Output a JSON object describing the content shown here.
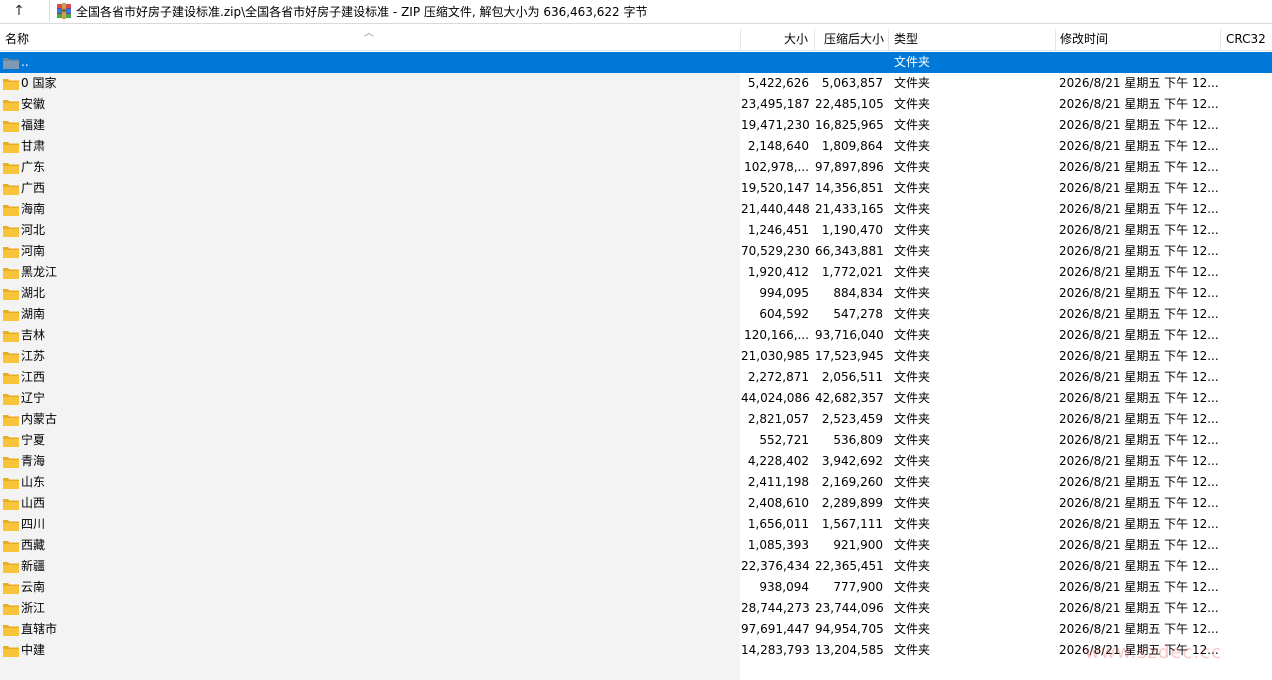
{
  "address_bar": {
    "path": "全国各省市好房子建设标准.zip\\全国各省市好房子建设标准 - ZIP 压缩文件, 解包大小为 636,463,622 字节",
    "up_glyph": "↑"
  },
  "columns": {
    "name": "名称",
    "size": "大小",
    "packed": "压缩后大小",
    "type": "类型",
    "modified": "修改时间",
    "crc": "CRC32"
  },
  "sort_glyph": "︿",
  "rows": [
    {
      "name": "..",
      "size": "",
      "packed": "",
      "type": "文件夹",
      "modified": "",
      "crc": "",
      "selected": true
    },
    {
      "name": "0 国家",
      "size": "5,422,626",
      "packed": "5,063,857",
      "type": "文件夹",
      "modified": "2026/8/21 星期五 下午 12...",
      "crc": ""
    },
    {
      "name": "安徽",
      "size": "23,495,187",
      "packed": "22,485,105",
      "type": "文件夹",
      "modified": "2026/8/21 星期五 下午 12...",
      "crc": ""
    },
    {
      "name": "福建",
      "size": "19,471,230",
      "packed": "16,825,965",
      "type": "文件夹",
      "modified": "2026/8/21 星期五 下午 12...",
      "crc": ""
    },
    {
      "name": "甘肃",
      "size": "2,148,640",
      "packed": "1,809,864",
      "type": "文件夹",
      "modified": "2026/8/21 星期五 下午 12...",
      "crc": ""
    },
    {
      "name": "广东",
      "size": "102,978,...",
      "packed": "97,897,896",
      "type": "文件夹",
      "modified": "2026/8/21 星期五 下午 12...",
      "crc": ""
    },
    {
      "name": "广西",
      "size": "19,520,147",
      "packed": "14,356,851",
      "type": "文件夹",
      "modified": "2026/8/21 星期五 下午 12...",
      "crc": ""
    },
    {
      "name": "海南",
      "size": "21,440,448",
      "packed": "21,433,165",
      "type": "文件夹",
      "modified": "2026/8/21 星期五 下午 12...",
      "crc": ""
    },
    {
      "name": "河北",
      "size": "1,246,451",
      "packed": "1,190,470",
      "type": "文件夹",
      "modified": "2026/8/21 星期五 下午 12...",
      "crc": ""
    },
    {
      "name": "河南",
      "size": "70,529,230",
      "packed": "66,343,881",
      "type": "文件夹",
      "modified": "2026/8/21 星期五 下午 12...",
      "crc": ""
    },
    {
      "name": "黑龙江",
      "size": "1,920,412",
      "packed": "1,772,021",
      "type": "文件夹",
      "modified": "2026/8/21 星期五 下午 12...",
      "crc": ""
    },
    {
      "name": "湖北",
      "size": "994,095",
      "packed": "884,834",
      "type": "文件夹",
      "modified": "2026/8/21 星期五 下午 12...",
      "crc": ""
    },
    {
      "name": "湖南",
      "size": "604,592",
      "packed": "547,278",
      "type": "文件夹",
      "modified": "2026/8/21 星期五 下午 12...",
      "crc": ""
    },
    {
      "name": "吉林",
      "size": "120,166,...",
      "packed": "93,716,040",
      "type": "文件夹",
      "modified": "2026/8/21 星期五 下午 12...",
      "crc": ""
    },
    {
      "name": "江苏",
      "size": "21,030,985",
      "packed": "17,523,945",
      "type": "文件夹",
      "modified": "2026/8/21 星期五 下午 12...",
      "crc": ""
    },
    {
      "name": "江西",
      "size": "2,272,871",
      "packed": "2,056,511",
      "type": "文件夹",
      "modified": "2026/8/21 星期五 下午 12...",
      "crc": ""
    },
    {
      "name": "辽宁",
      "size": "44,024,086",
      "packed": "42,682,357",
      "type": "文件夹",
      "modified": "2026/8/21 星期五 下午 12...",
      "crc": ""
    },
    {
      "name": "内蒙古",
      "size": "2,821,057",
      "packed": "2,523,459",
      "type": "文件夹",
      "modified": "2026/8/21 星期五 下午 12...",
      "crc": ""
    },
    {
      "name": "宁夏",
      "size": "552,721",
      "packed": "536,809",
      "type": "文件夹",
      "modified": "2026/8/21 星期五 下午 12...",
      "crc": ""
    },
    {
      "name": "青海",
      "size": "4,228,402",
      "packed": "3,942,692",
      "type": "文件夹",
      "modified": "2026/8/21 星期五 下午 12...",
      "crc": ""
    },
    {
      "name": "山东",
      "size": "2,411,198",
      "packed": "2,169,260",
      "type": "文件夹",
      "modified": "2026/8/21 星期五 下午 12...",
      "crc": ""
    },
    {
      "name": "山西",
      "size": "2,408,610",
      "packed": "2,289,899",
      "type": "文件夹",
      "modified": "2026/8/21 星期五 下午 12...",
      "crc": ""
    },
    {
      "name": "四川",
      "size": "1,656,011",
      "packed": "1,567,111",
      "type": "文件夹",
      "modified": "2026/8/21 星期五 下午 12...",
      "crc": ""
    },
    {
      "name": "西藏",
      "size": "1,085,393",
      "packed": "921,900",
      "type": "文件夹",
      "modified": "2026/8/21 星期五 下午 12...",
      "crc": ""
    },
    {
      "name": "新疆",
      "size": "22,376,434",
      "packed": "22,365,451",
      "type": "文件夹",
      "modified": "2026/8/21 星期五 下午 12...",
      "crc": ""
    },
    {
      "name": "云南",
      "size": "938,094",
      "packed": "777,900",
      "type": "文件夹",
      "modified": "2026/8/21 星期五 下午 12...",
      "crc": ""
    },
    {
      "name": "浙江",
      "size": "28,744,273",
      "packed": "23,744,096",
      "type": "文件夹",
      "modified": "2026/8/21 星期五 下午 12...",
      "crc": ""
    },
    {
      "name": "直辖市",
      "size": "97,691,447",
      "packed": "94,954,705",
      "type": "文件夹",
      "modified": "2026/8/21 星期五 下午 12...",
      "crc": ""
    },
    {
      "name": "中建",
      "size": "14,283,793",
      "packed": "13,204,585",
      "type": "文件夹",
      "modified": "2026/8/21 星期五 下午 12...",
      "crc": ""
    }
  ],
  "watermark": "www.szdec.cc",
  "colors": {
    "selection": "#0078d7",
    "folder_yellow": "#f8c53a",
    "folder_up": "#7f9bb3"
  },
  "icons": {
    "up": "up-arrow-icon",
    "archive": "winrar-archive-icon",
    "folder": "folder-icon",
    "parent_folder": "parent-folder-icon"
  }
}
